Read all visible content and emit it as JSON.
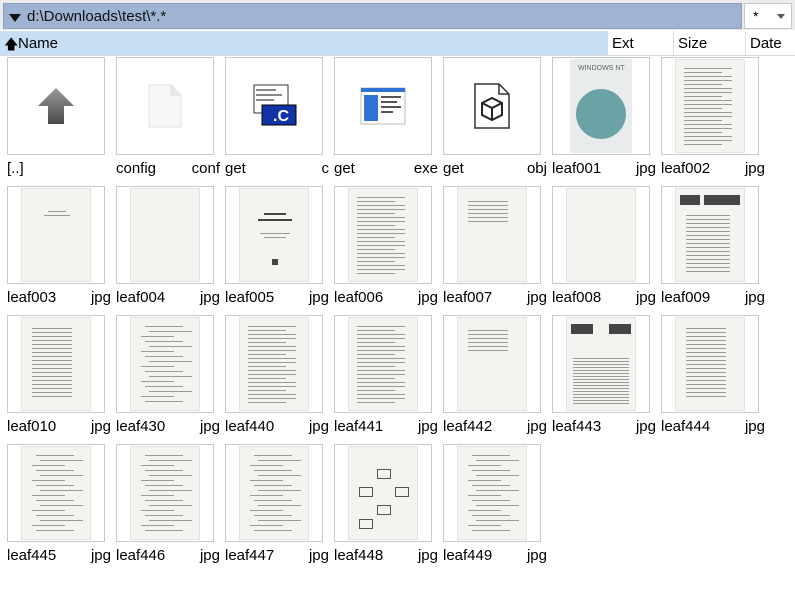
{
  "pathbar": {
    "path": "d:\\Downloads\\test\\*.*",
    "filter": "*"
  },
  "columns": {
    "name": "Name",
    "ext": "Ext",
    "size": "Size",
    "date": "Date"
  },
  "files": [
    {
      "name": "[..]",
      "ext": "",
      "kind": "parent-dir"
    },
    {
      "name": "config",
      "ext": "conf",
      "kind": "blank"
    },
    {
      "name": "get",
      "ext": "c",
      "kind": "c-source"
    },
    {
      "name": "get",
      "ext": "exe",
      "kind": "exe"
    },
    {
      "name": "get",
      "ext": "obj",
      "kind": "obj"
    },
    {
      "name": "leaf001",
      "ext": "jpg",
      "kind": "book-cover"
    },
    {
      "name": "leaf002",
      "ext": "jpg",
      "kind": "text-page"
    },
    {
      "name": "leaf003",
      "ext": "jpg",
      "kind": "title-small"
    },
    {
      "name": "leaf004",
      "ext": "jpg",
      "kind": "blank-page"
    },
    {
      "name": "leaf005",
      "ext": "jpg",
      "kind": "title-page"
    },
    {
      "name": "leaf006",
      "ext": "jpg",
      "kind": "text-page"
    },
    {
      "name": "leaf007",
      "ext": "jpg",
      "kind": "sparse-page"
    },
    {
      "name": "leaf008",
      "ext": "jpg",
      "kind": "blank-page"
    },
    {
      "name": "leaf009",
      "ext": "jpg",
      "kind": "contents-page"
    },
    {
      "name": "leaf010",
      "ext": "jpg",
      "kind": "toc-page"
    },
    {
      "name": "leaf430",
      "ext": "jpg",
      "kind": "code-page"
    },
    {
      "name": "leaf440",
      "ext": "jpg",
      "kind": "text-page"
    },
    {
      "name": "leaf441",
      "ext": "jpg",
      "kind": "text-page"
    },
    {
      "name": "leaf442",
      "ext": "jpg",
      "kind": "sparse-page"
    },
    {
      "name": "leaf443",
      "ext": "jpg",
      "kind": "chapter-page"
    },
    {
      "name": "leaf444",
      "ext": "jpg",
      "kind": "toc-page"
    },
    {
      "name": "leaf445",
      "ext": "jpg",
      "kind": "code-page"
    },
    {
      "name": "leaf446",
      "ext": "jpg",
      "kind": "code-page"
    },
    {
      "name": "leaf447",
      "ext": "jpg",
      "kind": "code-page"
    },
    {
      "name": "leaf448",
      "ext": "jpg",
      "kind": "diagram-page"
    },
    {
      "name": "leaf449",
      "ext": "jpg",
      "kind": "code-page"
    }
  ],
  "colors": {
    "path_bg": "#9fb4d3",
    "header_active": "#c7dff5"
  }
}
